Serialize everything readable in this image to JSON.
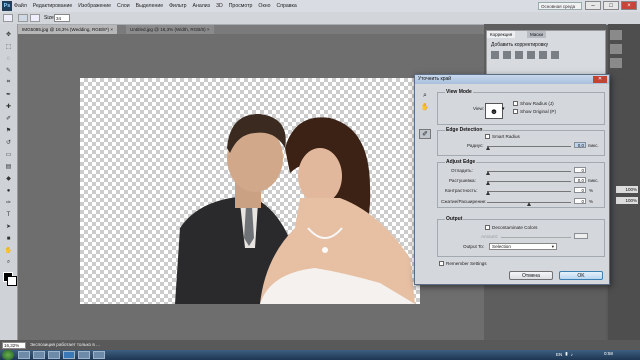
{
  "app": {
    "logo": "Ps"
  },
  "menubar": {
    "items": [
      "Файл",
      "Редактирование",
      "Изображение",
      "Слои",
      "Выделение",
      "Фильтр",
      "Анализ",
      "3D",
      "Просмотр",
      "Окно",
      "Справка"
    ],
    "workspace": "Основная среда"
  },
  "options": {
    "size_label": "Size:",
    "size_value": "34"
  },
  "tabs": [
    {
      "label": "IMG5085.jpg @ 16,3% (Wedding, RGB/8*) ×"
    },
    {
      "label": "Untitled.jpg @ 16,3% (Width, RGB/8) ×"
    }
  ],
  "panel": {
    "tabs": [
      "Коррекция",
      "Маски"
    ],
    "subtitle": "Добавить корректировку"
  },
  "right_panel": {
    "pct1": "100%",
    "pct2": "100%"
  },
  "status": {
    "zoom": "16,32%",
    "text": "Экспозиция работает только в ..."
  },
  "dialog": {
    "title": "Уточнить край",
    "view_mode": {
      "title": "View Mode",
      "view_label": "View:",
      "show_radius": "Show Radius (J)",
      "show_original": "Show Original (P)"
    },
    "edge_detection": {
      "title": "Edge Detection",
      "smart_radius": "Smart Radius",
      "radius_label": "Радиус:",
      "radius_value": "0,0",
      "radius_unit": "пикс."
    },
    "adjust_edge": {
      "title": "Adjust Edge",
      "smooth_label": "Отладить:",
      "smooth_value": "0",
      "feather_label": "Растушевка:",
      "feather_value": "0,0",
      "feather_unit": "пикс.",
      "contrast_label": "Контрастность:",
      "contrast_value": "0",
      "contrast_unit": "%",
      "shift_label": "Сжатие/Расширение:",
      "shift_value": "0",
      "shift_unit": "%"
    },
    "output": {
      "title": "Output",
      "decontaminate": "Decontaminate Colors",
      "amount_label": "Amount:",
      "output_to_label": "Output To:",
      "output_to_value": "Selection"
    },
    "remember": "Remember Settings",
    "cancel": "Отмена",
    "ok": "OK"
  },
  "taskbar": {
    "lang": "EN",
    "time": "0:58"
  }
}
